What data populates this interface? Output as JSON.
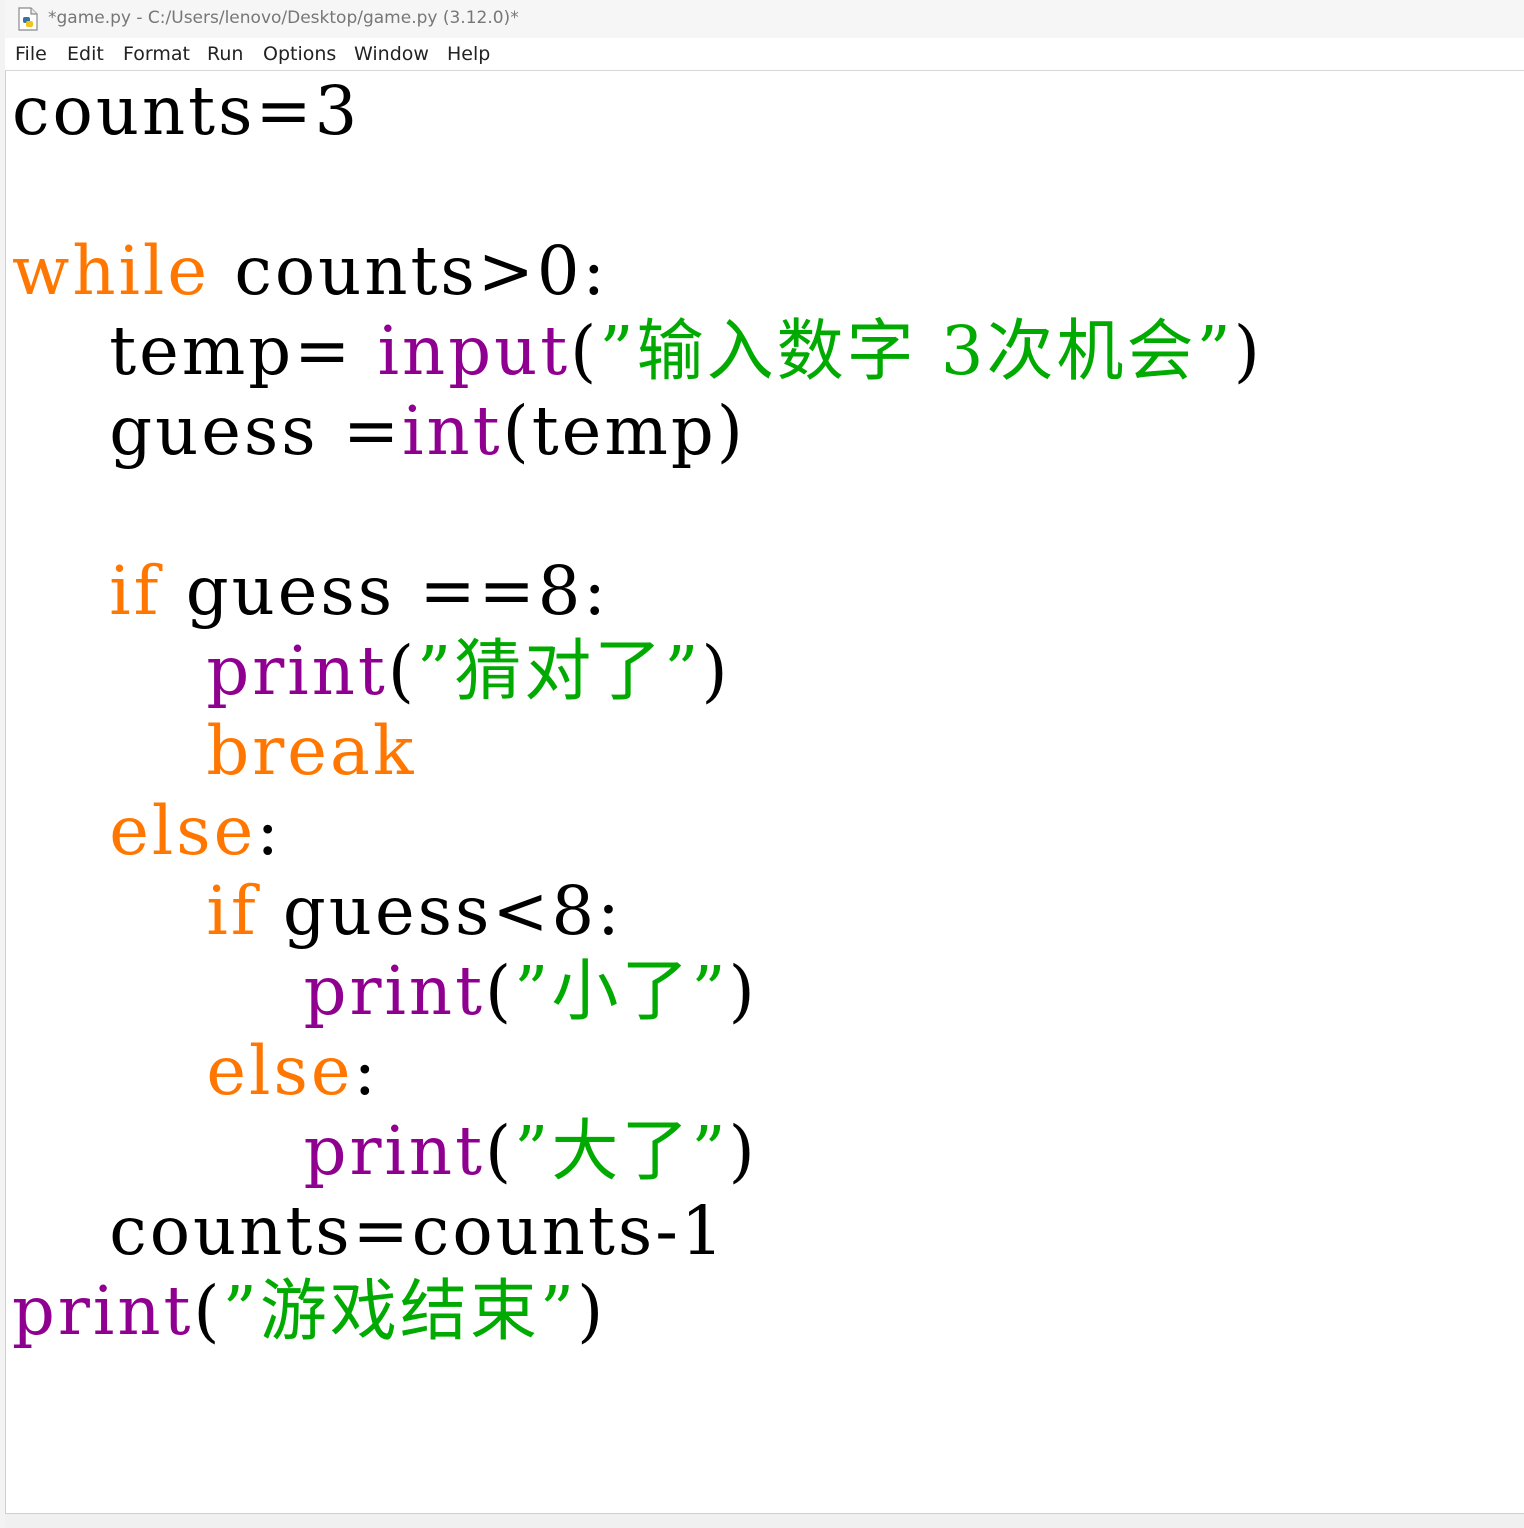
{
  "window": {
    "title": "*game.py - C:/Users/lenovo/Desktop/game.py (3.12.0)*"
  },
  "menu": {
    "items": [
      "File",
      "Edit",
      "Format",
      "Run",
      "Options",
      "Window",
      "Help"
    ]
  },
  "colors": {
    "keyword": "#ff7700",
    "builtin": "#900090",
    "string": "#00aa00",
    "default": "#000000"
  },
  "code": {
    "lines": [
      [
        {
          "t": "plain",
          "v": "counts=3"
        }
      ],
      [],
      [
        {
          "t": "kw",
          "v": "while"
        },
        {
          "t": "plain",
          "v": " counts>0:"
        }
      ],
      [
        {
          "t": "plain",
          "v": "    temp= "
        },
        {
          "t": "bi",
          "v": "input"
        },
        {
          "t": "plain",
          "v": "("
        },
        {
          "t": "str",
          "v": "”输入数字 3次机会”"
        },
        {
          "t": "plain",
          "v": ")"
        }
      ],
      [
        {
          "t": "plain",
          "v": "    guess ="
        },
        {
          "t": "bi",
          "v": "int"
        },
        {
          "t": "plain",
          "v": "(temp)"
        }
      ],
      [],
      [
        {
          "t": "plain",
          "v": "    "
        },
        {
          "t": "kw",
          "v": "if"
        },
        {
          "t": "plain",
          "v": " guess ==8:"
        }
      ],
      [
        {
          "t": "plain",
          "v": "        "
        },
        {
          "t": "bi",
          "v": "print"
        },
        {
          "t": "plain",
          "v": "("
        },
        {
          "t": "str",
          "v": "”猜对了”"
        },
        {
          "t": "plain",
          "v": ")"
        }
      ],
      [
        {
          "t": "plain",
          "v": "        "
        },
        {
          "t": "kw",
          "v": "break"
        }
      ],
      [
        {
          "t": "plain",
          "v": "    "
        },
        {
          "t": "kw",
          "v": "else"
        },
        {
          "t": "plain",
          "v": ":"
        }
      ],
      [
        {
          "t": "plain",
          "v": "        "
        },
        {
          "t": "kw",
          "v": "if"
        },
        {
          "t": "plain",
          "v": " guess<8:"
        }
      ],
      [
        {
          "t": "plain",
          "v": "            "
        },
        {
          "t": "bi",
          "v": "print"
        },
        {
          "t": "plain",
          "v": "("
        },
        {
          "t": "str",
          "v": "”小了”"
        },
        {
          "t": "plain",
          "v": ")"
        }
      ],
      [
        {
          "t": "plain",
          "v": "        "
        },
        {
          "t": "kw",
          "v": "else"
        },
        {
          "t": "plain",
          "v": ":"
        }
      ],
      [
        {
          "t": "plain",
          "v": "            "
        },
        {
          "t": "bi",
          "v": "print"
        },
        {
          "t": "plain",
          "v": "("
        },
        {
          "t": "str",
          "v": "”大了”"
        },
        {
          "t": "plain",
          "v": ")"
        }
      ],
      [
        {
          "t": "plain",
          "v": "    counts=counts-1"
        }
      ],
      [
        {
          "t": "bi",
          "v": "print"
        },
        {
          "t": "plain",
          "v": "("
        },
        {
          "t": "str",
          "v": "”游戏结束”"
        },
        {
          "t": "plain",
          "v": ")"
        }
      ]
    ]
  }
}
